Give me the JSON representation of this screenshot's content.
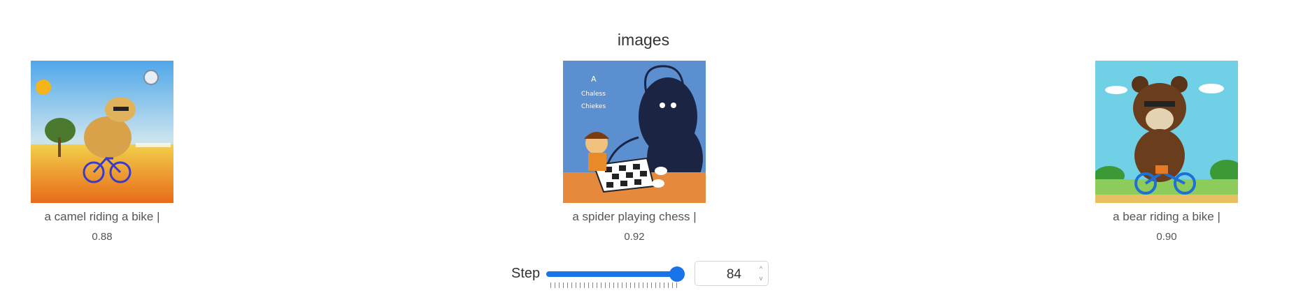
{
  "panel": {
    "title": "images"
  },
  "cards": [
    {
      "caption": "a camel riding a bike |",
      "score": "0.88",
      "image_alt": "camel riding a bike painting"
    },
    {
      "caption": "a spider playing chess |",
      "score": "0.92",
      "image_alt": "spider playing chess illustration",
      "image_text": [
        "A",
        "Chaless",
        "Chiekes"
      ]
    },
    {
      "caption": "a bear riding a bike |",
      "score": "0.90",
      "image_alt": "bear riding a bike illustration"
    }
  ],
  "step": {
    "label": "Step",
    "value": "84",
    "slider_fraction": 0.97,
    "spin_up": "^",
    "spin_down": "v"
  },
  "colors": {
    "accent": "#1a73e8",
    "track": "#dcdcdc"
  }
}
